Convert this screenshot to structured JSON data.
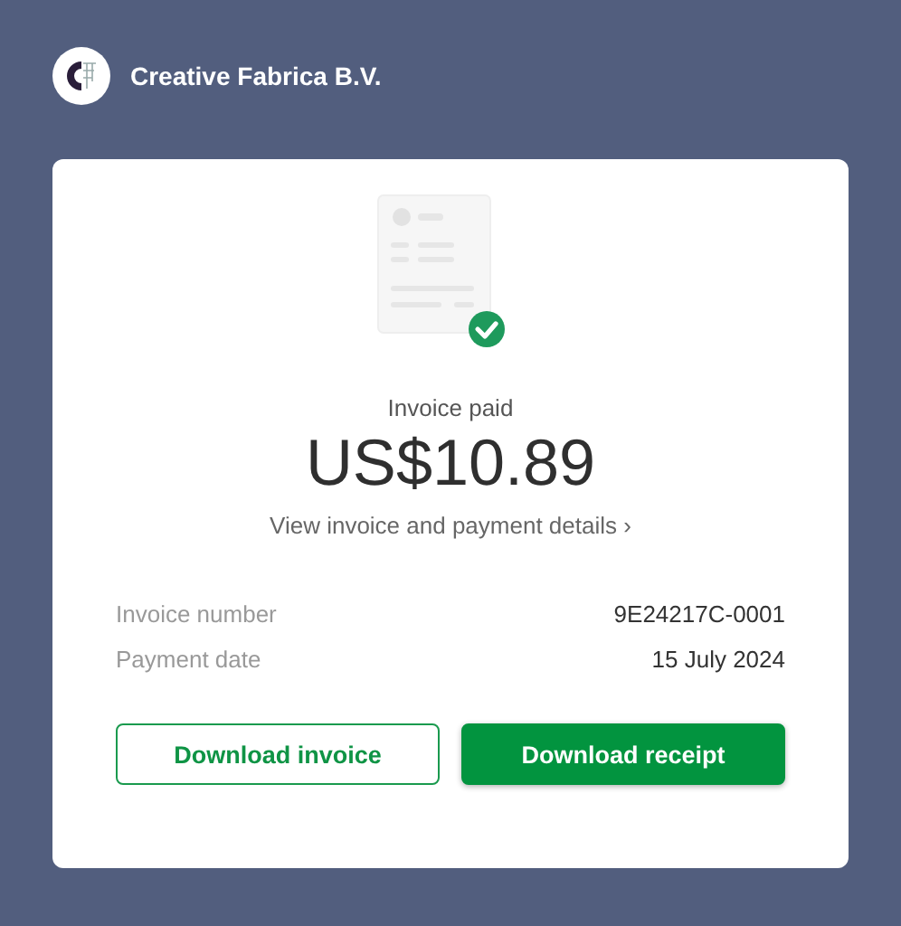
{
  "merchant": {
    "name": "Creative Fabrica B.V."
  },
  "invoice": {
    "status": "Invoice paid",
    "amount": "US$10.89",
    "details_link": "View invoice and payment details",
    "link_chevron": "›"
  },
  "fields": [
    {
      "label": "Invoice number",
      "value": "9E24217C-0001"
    },
    {
      "label": "Payment date",
      "value": "15 July 2024"
    }
  ],
  "buttons": [
    {
      "label": "Download invoice",
      "kind": "outline"
    },
    {
      "label": "Download receipt",
      "kind": "primary"
    }
  ]
}
